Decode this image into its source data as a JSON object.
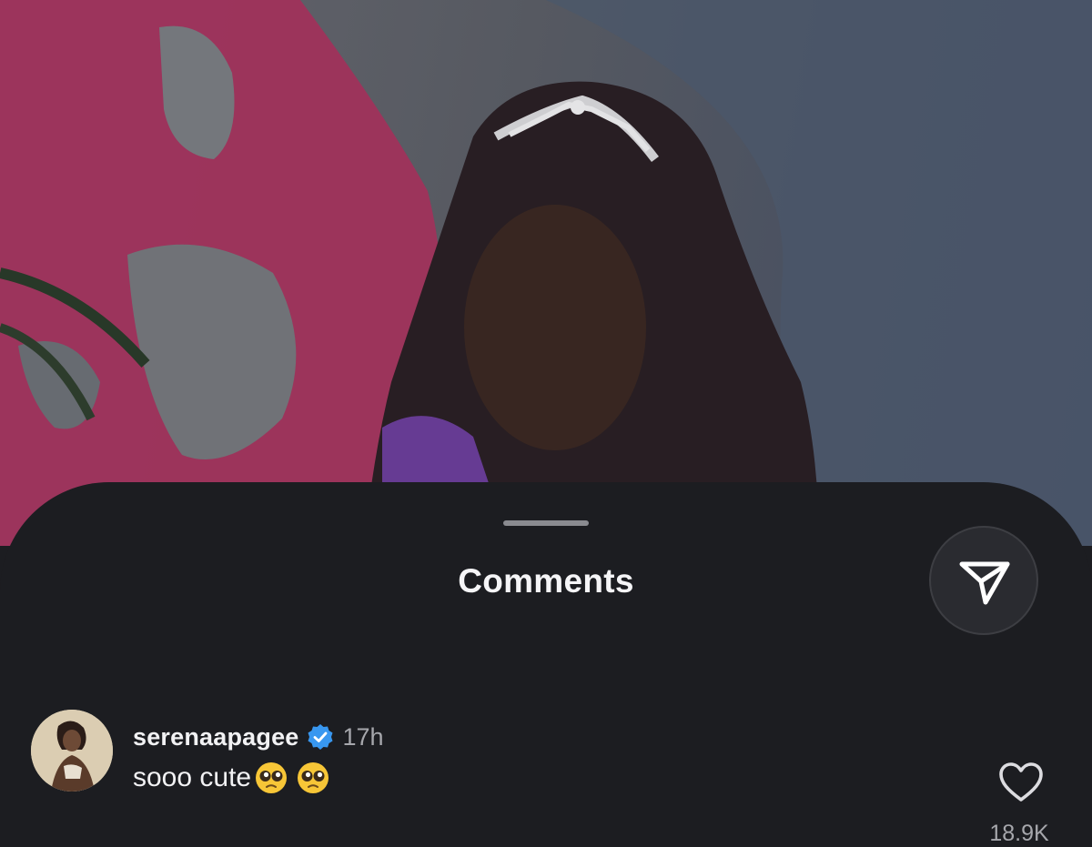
{
  "sheet": {
    "title": "Comments"
  },
  "icons": {
    "share": "paper-plane-icon",
    "verified": "verified-badge-icon",
    "like": "heart-outline-icon",
    "emoji": "pleading-face-emoji"
  },
  "comments": [
    {
      "username": "serenaapagee",
      "verified": true,
      "time": "17h",
      "text": "sooo cute",
      "emojis": [
        "🥹",
        "🥹"
      ],
      "likes": "18.9K"
    }
  ],
  "colors": {
    "sheet_bg": "#1c1d21",
    "verified_blue": "#3897f0",
    "muted_text": "#a6a7ac"
  }
}
